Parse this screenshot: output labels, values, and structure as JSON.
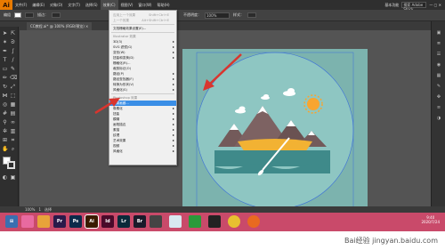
{
  "menubar": {
    "logo": "Ai",
    "items": [
      "文件(F)",
      "编辑(E)",
      "对象(O)",
      "文字(T)",
      "选择(S)",
      "效果(C)",
      "视图(V)",
      "窗口(W)",
      "帮助(H)"
    ],
    "active_index": 5,
    "right": [
      "基本功能",
      "搜索 Adobe Stock"
    ]
  },
  "controlbar": {
    "label1": "编组",
    "label2": "描边：",
    "label3": "不透明度：",
    "opacity": "100%",
    "label4": "样式："
  },
  "doctab": {
    "title": "CC教程.ai* @ 100% (RGB/预览)",
    "close": "×"
  },
  "effect_menu": {
    "top": [
      {
        "label": "应用上一个效果",
        "shortcut": "Shift+Ctrl+E"
      },
      {
        "label": "上一个效果",
        "shortcut": "Alt+Shift+Ctrl+E"
      }
    ],
    "doc_raster": "文档栅格效果设置(E)...",
    "illustrator_header": "Illustrator 效果",
    "illustrator_items": [
      "3D(3)",
      "SVG 滤镜(G)",
      "变形(W)",
      "扭曲和变换(D)",
      "栅格化(R)...",
      "裁剪标记(O)",
      "路径(P)",
      "路径查找器(F)",
      "转换为形状(V)",
      "风格化(S)"
    ],
    "photoshop_header": "Photoshop 效果",
    "photoshop_items": [
      "效果画廊...",
      "像素化",
      "扭曲",
      "模糊",
      "画笔描边",
      "素描",
      "纹理",
      "艺术效果",
      "视频",
      "风格化"
    ],
    "highlight_index": 0
  },
  "statusbar": {
    "zoom": "100%",
    "page": "1",
    "mode": "选择"
  },
  "taskbar": {
    "apps": [
      "",
      "",
      "Pr",
      "Ps",
      "Ai",
      "Id",
      "Lr",
      "Br",
      "",
      "",
      "",
      "",
      "",
      ""
    ],
    "time": "9:40",
    "date": "2020/7/24"
  },
  "watermark": "Bai经验  jingyan.baidu.com",
  "colors": {
    "sky": "#7cb3ae",
    "circle": "#8ec6c2",
    "mountain": "#735a5a",
    "boat": "#f2b233",
    "water": "#3f8a8a",
    "sun": "#f7a531",
    "arrow": "#d9352e"
  }
}
